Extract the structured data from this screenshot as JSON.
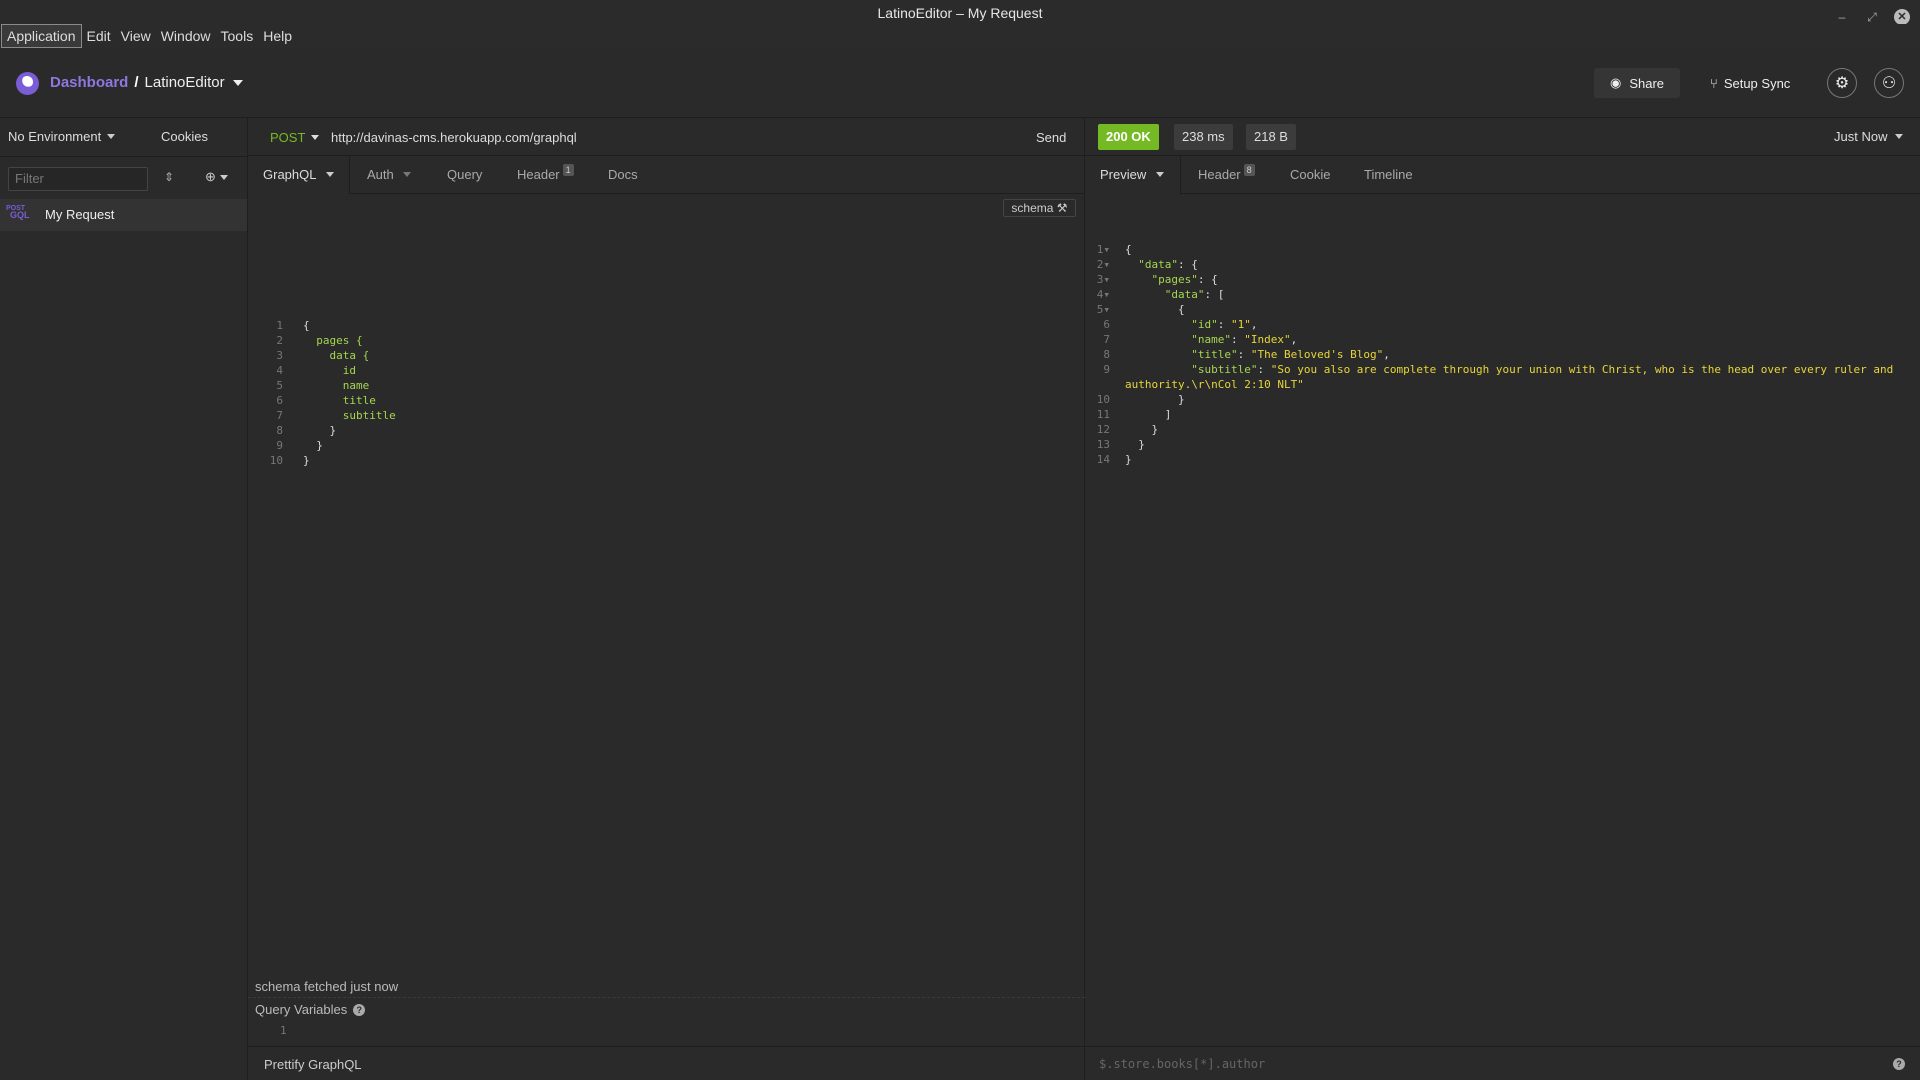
{
  "window": {
    "title": "LatinoEditor – My Request"
  },
  "menu": [
    "Application",
    "Edit",
    "View",
    "Window",
    "Tools",
    "Help"
  ],
  "header": {
    "dashboard": "Dashboard",
    "separator": "/",
    "workspace": "LatinoEditor",
    "share": "Share",
    "sync": "Setup Sync"
  },
  "sidebar": {
    "environment": "No Environment",
    "cookies": "Cookies",
    "filter_placeholder": "Filter",
    "request": {
      "method_tag": "POST",
      "type_tag": "GQL",
      "name": "My Request"
    }
  },
  "request": {
    "method": "POST",
    "url": "http://davinas-cms.herokuapp.com/graphql",
    "send": "Send",
    "tabs": {
      "body": "GraphQL",
      "auth": "Auth",
      "query": "Query",
      "header": "Header",
      "header_count": "1",
      "docs": "Docs"
    },
    "schema_button": "schema",
    "code_lines": [
      {
        "n": "1",
        "text": "{"
      },
      {
        "n": "2",
        "text": "  pages {"
      },
      {
        "n": "3",
        "text": "    data {"
      },
      {
        "n": "4",
        "text": "      id"
      },
      {
        "n": "5",
        "text": "      name"
      },
      {
        "n": "6",
        "text": "      title"
      },
      {
        "n": "7",
        "text": "      subtitle"
      },
      {
        "n": "8",
        "text": "    }"
      },
      {
        "n": "9",
        "text": "  }"
      },
      {
        "n": "10",
        "text": "}"
      }
    ],
    "schema_status": "schema fetched just now",
    "query_variables": "Query Variables",
    "qv_line": "1",
    "prettify": "Prettify GraphQL"
  },
  "response": {
    "status": "200 OK",
    "time": "238 ms",
    "size": "218 B",
    "when": "Just Now",
    "tabs": {
      "preview": "Preview",
      "header": "Header",
      "header_count": "8",
      "cookie": "Cookie",
      "timeline": "Timeline"
    },
    "lines": {
      "l1": "{",
      "l2k": "\"data\"",
      "l2r": ": {",
      "l3k": "\"pages\"",
      "l3r": ": {",
      "l4k": "\"data\"",
      "l4r": ": [",
      "l5": "{",
      "l6k": "\"id\"",
      "l6v": "\"1\"",
      "l7k": "\"name\"",
      "l7v": "\"Index\"",
      "l8k": "\"title\"",
      "l8v": "\"The Beloved's Blog\"",
      "l9k": "\"subtitle\"",
      "l9v": "\"So you also are complete through your union with Christ, who is the head over every ruler and",
      "l9b": "authority.\\r\\nCol 2:10 NLT\"",
      "l10": "}",
      "l11": "]",
      "l12": "}",
      "l13": "}",
      "l14": "}"
    },
    "filter_placeholder": "$.store.books[*].author"
  }
}
